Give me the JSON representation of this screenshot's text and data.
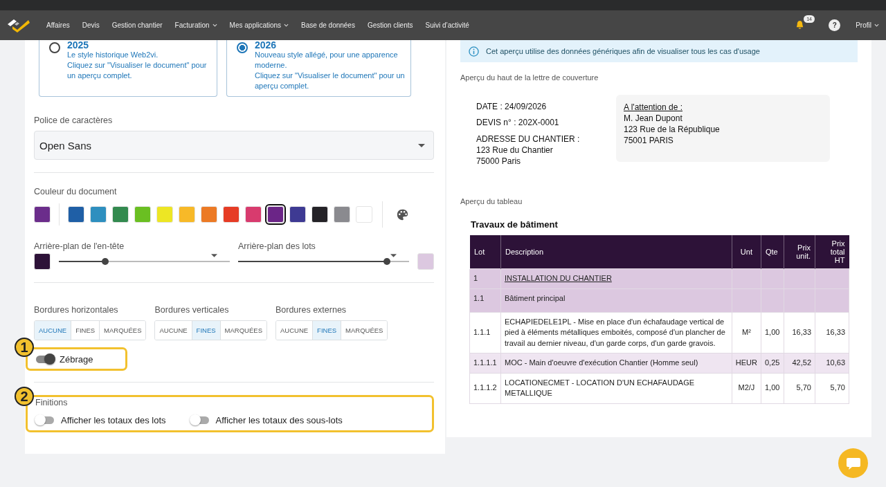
{
  "navbar": {
    "items": [
      {
        "label": "Affaires",
        "has_menu": false
      },
      {
        "label": "Devis",
        "has_menu": false
      },
      {
        "label": "Gestion chantier",
        "has_menu": false
      },
      {
        "label": "Facturation",
        "has_menu": true
      },
      {
        "label": "Mes applications",
        "has_menu": true
      },
      {
        "label": "Base de données",
        "has_menu": false
      },
      {
        "label": "Gestion clients",
        "has_menu": false
      },
      {
        "label": "Suivi d’activité",
        "has_menu": false
      }
    ],
    "notifications": {
      "count": "14"
    },
    "help": {
      "label": "?"
    },
    "profile": {
      "label": "Profil"
    }
  },
  "styles": [
    {
      "title": "2025",
      "lines": [
        "Le style historique Web2vi.",
        "Cliquez sur \"Visualiser le document\" pour un aperçu complet."
      ],
      "selected": false
    },
    {
      "title": "2026",
      "lines": [
        "Nouveau style allégé, pour une apparence moderne.",
        "Cliquez sur \"Visualiser le document\" pour un aperçu complet."
      ],
      "selected": true
    }
  ],
  "font": {
    "label": "Police de caractères",
    "value": "Open Sans"
  },
  "document_color": {
    "label": "Couleur du document",
    "current": {
      "color": "#6b2d8b"
    },
    "swatches": [
      {
        "color": "#1f5fa6",
        "selected": false
      },
      {
        "color": "#2e8fbf",
        "selected": false
      },
      {
        "color": "#338a4f",
        "selected": false
      },
      {
        "color": "#6abf22",
        "selected": false
      },
      {
        "color": "#ede624",
        "selected": false
      },
      {
        "color": "#f7b928",
        "selected": false
      },
      {
        "color": "#ec7a25",
        "selected": false
      },
      {
        "color": "#e63c25",
        "selected": false
      },
      {
        "color": "#d83b6e",
        "selected": false
      },
      {
        "color": "#6b2587",
        "selected": true
      },
      {
        "color": "#3e3a93",
        "selected": false
      },
      {
        "color": "#242227",
        "selected": false
      },
      {
        "color": "#8a8a8f",
        "selected": false
      },
      {
        "color": "#ffffff",
        "selected": false
      }
    ]
  },
  "header_background": {
    "label": "Arrière-plan de l'en-tête",
    "color": "#2d1238",
    "level": 0.27
  },
  "lots_background": {
    "label": "Arrière-plan des lots",
    "color": "#dcc8e0",
    "level": 0.87
  },
  "borders": [
    {
      "label": "Bordures horizontales",
      "options": [
        {
          "label": "AUCUNE",
          "selected": true
        },
        {
          "label": "FINES",
          "selected": false
        },
        {
          "label": "MARQUÉES",
          "selected": false
        }
      ]
    },
    {
      "label": "Bordures verticales",
      "options": [
        {
          "label": "AUCUNE",
          "selected": false
        },
        {
          "label": "FINES",
          "selected": true
        },
        {
          "label": "MARQUÉES",
          "selected": false
        }
      ]
    },
    {
      "label": "Bordures externes",
      "options": [
        {
          "label": "AUCUNE",
          "selected": false
        },
        {
          "label": "FINES",
          "selected": true
        },
        {
          "label": "MARQUÉES",
          "selected": false
        }
      ]
    }
  ],
  "zebra": {
    "label": "Zébrage",
    "on": true,
    "annotation": "1"
  },
  "finishing": {
    "title": "Finitions",
    "annotation": "2",
    "toggles": [
      {
        "label": "Afficher les totaux des lots",
        "on": false
      },
      {
        "label": "Afficher les totaux des sous-lots",
        "on": false
      }
    ]
  },
  "info_banner": {
    "text": "Cet aperçu utilise des données génériques afin de visualiser tous les cas d'usage"
  },
  "letter_preview": {
    "label": "Aperçu du haut de la lettre de couverture",
    "date": "DATE : 24/09/2026",
    "quote_number": "DEVIS n° : 202X-0001",
    "address_lines": [
      "ADRESSE DU CHANTIER :",
      "123 Rue du Chantier",
      "75000 Paris"
    ],
    "recipient": {
      "heading": "A l'attention de :",
      "lines": [
        "M. Jean Dupont",
        "123 Rue de la République",
        "75001 PARIS"
      ]
    }
  },
  "table_preview": {
    "label": "Aperçu du tableau",
    "title": "Travaux de bâtiment",
    "columns": [
      "Lot",
      "Description",
      "Unt",
      "Qte",
      "Prix unit.",
      "Prix total HT"
    ],
    "rows": [
      {
        "kind": "lot",
        "cells": [
          "1",
          "INSTALLATION DU CHANTIER",
          "",
          "",
          "",
          ""
        ]
      },
      {
        "kind": "sublot",
        "cells": [
          "1.1",
          "Bâtiment principal",
          "",
          "",
          "",
          ""
        ]
      },
      {
        "kind": "item",
        "cells": [
          "1.1.1",
          "ECHAPIEDELE1PL - Mise en place d'un échafaudage vertical de pied à éléments métalliques emboités, composé d'un plancher de travail au dernier niveau, d'un garde corps, d'un garde gravois.",
          "M²",
          "1,00",
          "16,33",
          "16,33"
        ]
      },
      {
        "kind": "item",
        "cells": [
          "1.1.1.1",
          "MOC - Main d'oeuvre d'exécution Chantier (Homme seul)",
          "HEUR",
          "0,25",
          "42,52",
          "10,63"
        ]
      },
      {
        "kind": "item",
        "cells": [
          "1.1.1.2",
          "LOCATIONECMET - LOCATION D'UN ECHAFAUDAGE METALLIQUE",
          "M2/J",
          "1,00",
          "5,70",
          "5,70"
        ]
      }
    ]
  }
}
